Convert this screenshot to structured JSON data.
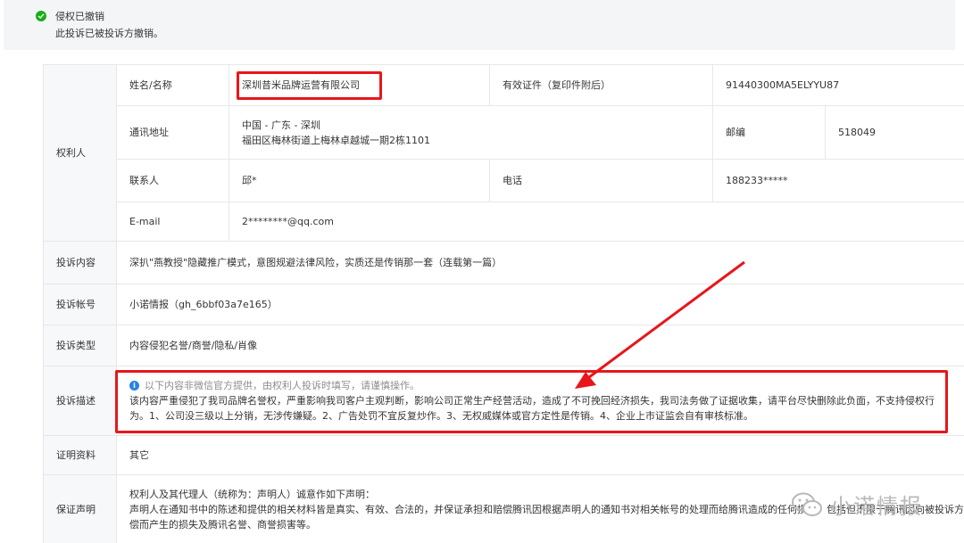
{
  "banner": {
    "status_title": "侵权已撤销",
    "status_desc": "此投诉已被投诉方撤销。"
  },
  "rights_holder": {
    "section_label": "权利人",
    "name_label": "姓名/名称",
    "name_value": "深圳昔米品牌运营有限公司",
    "cert_label": "有效证件（复印件附后）",
    "cert_value": "91440300MA5ELYYU87",
    "address_label": "通讯地址",
    "address_line1": "中国 - 广东 - 深圳",
    "address_line2": "福田区梅林街道上梅林卓越城一期2栋1101",
    "postcode_label": "邮编",
    "postcode_value": "518049",
    "contact_label": "联系人",
    "contact_value": "邱*",
    "phone_label": "电话",
    "phone_value": "188233*****",
    "email_label": "E-mail",
    "email_value": "2********@qq.com"
  },
  "complaint": {
    "content_label": "投诉内容",
    "content_value": "深扒\"燕教授\"隐藏推广模式，意图规避法律风险，实质还是传销那一套（连载第一篇）",
    "account_label": "投诉帐号",
    "account_value": "小诺情报（gh_6bbf03a7e165）",
    "type_label": "投诉类型",
    "type_value": "内容侵犯名誉/商誉/隐私/肖像",
    "desc_label": "投诉描述",
    "desc_notice": "以下内容非微信官方提供，由权利人投诉时填写，请谨慎操作。",
    "desc_text": "该内容严重侵犯了我司品牌名誉权，严重影响我司客户主观判断，影响公司正常生产经营活动，造成了不可挽回经济损失，我司法务做了证据收集，请平台尽快删除此负面，不支持侵权行为。1、公司没三级以上分销，无涉传嫌疑。2、广告处罚不宜反复炒作。3、无权威媒体或官方定性是传销。4、企业上市证监会自有审核标准。",
    "proof_label": "证明资料",
    "proof_value": "其它",
    "guarantee_label": "保证声明",
    "guarantee_line1": "权利人及其代理人（统称为：声明人）诚意作如下声明：",
    "guarantee_line2": "声明人在通知书中的陈述和提供的相关材料皆是真实、有效、合法的，并保证承担和赔偿腾讯因根据声明人的通知书对相关帐号的处理而给腾讯造成的任何损失，包括但不限于腾讯因向被投诉方或用户赔",
    "guarantee_line3": "偿而产生的损失及腾讯名誉、商誉损害等。"
  },
  "watermark": {
    "text": "小诺情报"
  },
  "colors": {
    "highlight": "#e8161b",
    "success": "#1aad19",
    "info": "#2a82e4"
  }
}
